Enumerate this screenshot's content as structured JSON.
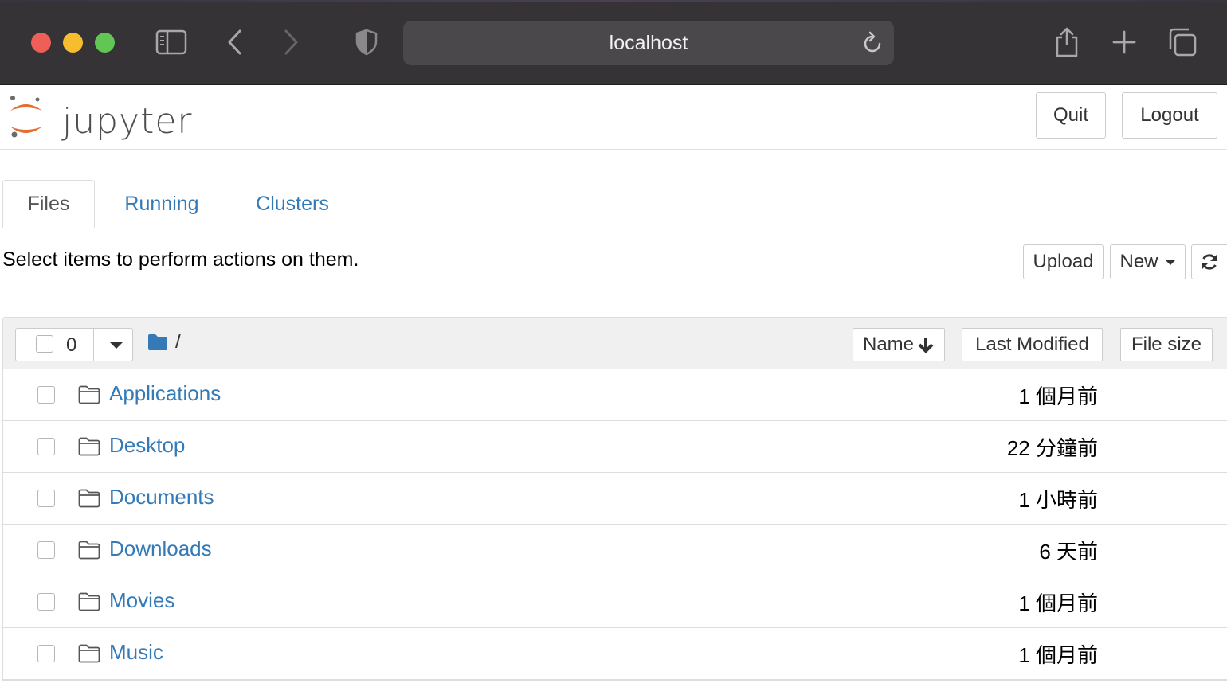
{
  "browser": {
    "url": "localhost"
  },
  "header": {
    "logo_text": "jupyter",
    "quit_label": "Quit",
    "logout_label": "Logout"
  },
  "tabs": [
    {
      "label": "Files",
      "active": true
    },
    {
      "label": "Running",
      "active": false
    },
    {
      "label": "Clusters",
      "active": false
    }
  ],
  "toolbar": {
    "hint": "Select items to perform actions on them.",
    "upload_label": "Upload",
    "new_label": "New"
  },
  "list": {
    "selected_count": "0",
    "breadcrumb": "/",
    "columns": {
      "name": "Name",
      "last_modified": "Last Modified",
      "file_size": "File size"
    },
    "rows": [
      {
        "name": "Applications",
        "modified": "1 個月前"
      },
      {
        "name": "Desktop",
        "modified": "22 分鐘前"
      },
      {
        "name": "Documents",
        "modified": "1 小時前"
      },
      {
        "name": "Downloads",
        "modified": "6 天前"
      },
      {
        "name": "Movies",
        "modified": "1 個月前"
      },
      {
        "name": "Music",
        "modified": "1 個月前"
      }
    ]
  },
  "colors": {
    "link": "#337ab7",
    "jupyter_orange": "#e46e2e",
    "chrome_bg": "#353335"
  },
  "icons": [
    "sidebar-icon",
    "back-icon",
    "forward-icon",
    "shield-icon",
    "reload-icon",
    "share-icon",
    "new-tab-icon",
    "tabs-overview-icon",
    "refresh-icon",
    "folder-icon",
    "sort-down-icon"
  ]
}
